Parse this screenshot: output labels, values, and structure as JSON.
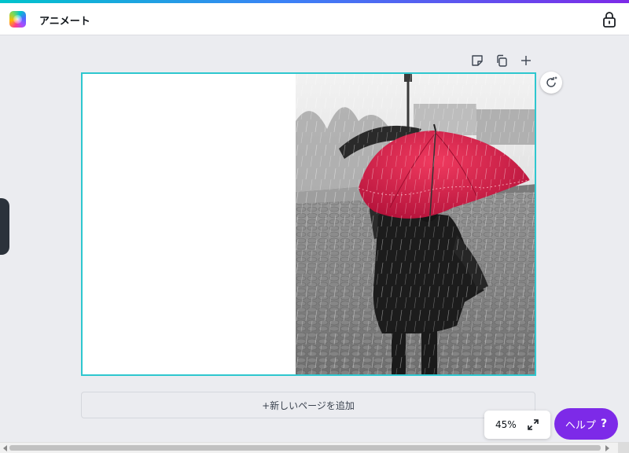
{
  "header": {
    "title": "アニメート",
    "app_icon": "canva-color-app-icon",
    "lock_icon": "lock-icon"
  },
  "canvas_toolbar": {
    "icons": [
      "sticky-note-icon",
      "duplicate-page-icon",
      "add-page-icon"
    ],
    "regenerate_icon": "refresh-sparkle-icon"
  },
  "canvas": {
    "image_icon": "photo-woman-red-umbrella",
    "border_color": "#2ec7cf"
  },
  "add_page": {
    "label": "+新しいページを追加"
  },
  "zoom": {
    "value": "45%",
    "icon": "expand-icon"
  },
  "help": {
    "label": "ヘルプ",
    "icon": "?",
    "color": "#7d2ae8"
  }
}
